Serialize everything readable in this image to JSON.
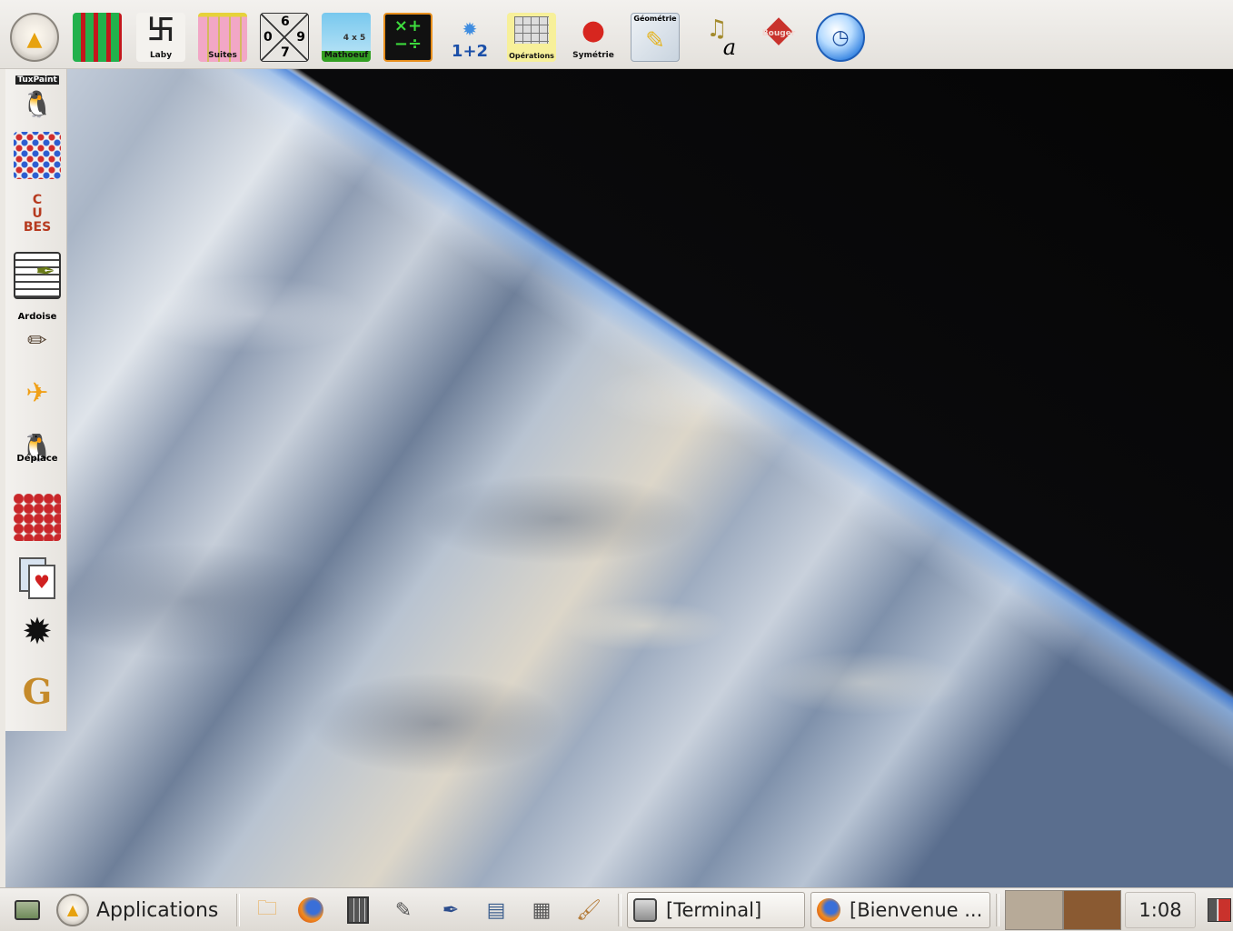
{
  "top_launchers": [
    {
      "name": "gnome-foot-launcher",
      "caption": "",
      "glyph": "",
      "icon": "gnome-foot-icon"
    },
    {
      "name": "maze-game-launcher",
      "caption": "",
      "glyph": "",
      "icon": "green-maze-icon"
    },
    {
      "name": "laby-launcher",
      "caption": "Laby",
      "glyph": "",
      "icon": "labyrinth-icon"
    },
    {
      "name": "suites-launcher",
      "caption": "Suites",
      "glyph": "",
      "icon": "color-grid-icon"
    },
    {
      "name": "number-square-launcher",
      "caption": "",
      "glyph": "",
      "icon": "number-cross-icon",
      "numbers": [
        "6",
        "0",
        "9",
        "7"
      ]
    },
    {
      "name": "mathoeuf-launcher",
      "caption": "Mathoeuf",
      "glyph": "4 x 5",
      "icon": "egg-math-icon"
    },
    {
      "name": "arithmetic-operators-launcher",
      "caption": "",
      "glyph": "×+ −÷",
      "icon": "operators-icon"
    },
    {
      "name": "one-plus-two-launcher",
      "caption": "",
      "glyph": "1+2",
      "icon": "flame-sum-icon"
    },
    {
      "name": "operations-launcher",
      "caption": "Opérations",
      "glyph": "",
      "icon": "calculator-grid-icon"
    },
    {
      "name": "symetrie-launcher",
      "caption": "Symétrie",
      "glyph": "",
      "icon": "ladybug-icon"
    },
    {
      "name": "geometrie-launcher",
      "caption": "Géométrie",
      "glyph": "",
      "icon": "geometry-pencil-icon"
    },
    {
      "name": "music-notes-launcher",
      "caption": "",
      "glyph": "a",
      "icon": "music-notes-icon"
    },
    {
      "name": "bouger-launcher",
      "caption": "Bouger",
      "glyph": "",
      "icon": "red-gem-icon"
    },
    {
      "name": "clock-launcher",
      "caption": "",
      "glyph": "",
      "icon": "blue-clock-icon"
    }
  ],
  "side_launchers": [
    {
      "name": "tuxpaint-launcher",
      "caption": "TuxPaint",
      "icon": "tux-paint-icon"
    },
    {
      "name": "colored-dots-launcher",
      "caption": "",
      "icon": "dot-grid-icon"
    },
    {
      "name": "cubes-launcher",
      "caption": "",
      "icon": "letter-blocks-icon"
    },
    {
      "name": "text-editor-launcher",
      "caption": "",
      "icon": "notepad-quill-icon"
    },
    {
      "name": "ardoise-launcher",
      "caption": "Ardoise",
      "icon": "slate-pencil-icon"
    },
    {
      "name": "airplane-launcher",
      "caption": "",
      "icon": "airplane-icon"
    },
    {
      "name": "deplace-launcher",
      "caption": "Déplace",
      "icon": "tux-move-icon"
    },
    {
      "name": "balls-pyramid-launcher",
      "caption": "",
      "icon": "balls-pyramid-icon"
    },
    {
      "name": "cards-launcher",
      "caption": "",
      "icon": "playing-cards-icon"
    },
    {
      "name": "mines-launcher",
      "caption": "",
      "icon": "mine-icon"
    },
    {
      "name": "maze-g-launcher",
      "caption": "",
      "icon": "maze-letter-icon"
    }
  ],
  "taskbar": {
    "show_desktop_icon": "show-desktop-icon",
    "applications_label": "Applications",
    "quick_launch": [
      {
        "name": "home-folder-launcher",
        "icon": "home-folder-icon"
      },
      {
        "name": "firefox-launcher",
        "icon": "firefox-icon"
      },
      {
        "name": "calculator-launcher",
        "icon": "calculator-icon"
      },
      {
        "name": "text-editor-quick-launcher",
        "icon": "writing-icon"
      },
      {
        "name": "writer-launcher",
        "icon": "pen-icon"
      },
      {
        "name": "file-cabinet-launcher",
        "icon": "file-cabinet-icon"
      },
      {
        "name": "presentation-launcher",
        "icon": "presentation-icon"
      },
      {
        "name": "paint-launcher",
        "icon": "paint-brush-icon"
      }
    ],
    "tasks": [
      {
        "name": "task-terminal",
        "label": "[Terminal]",
        "icon": "terminal-icon"
      },
      {
        "name": "task-bienvenue",
        "label": "[Bienvenue ...",
        "icon": "firefox-icon"
      }
    ],
    "clock": "1:08",
    "logout_icon": "logout-icon"
  },
  "colors": {
    "panel_bg": "#ebe8e3",
    "workspace_1": "#b7aa98",
    "workspace_2": "#8a5a32"
  }
}
